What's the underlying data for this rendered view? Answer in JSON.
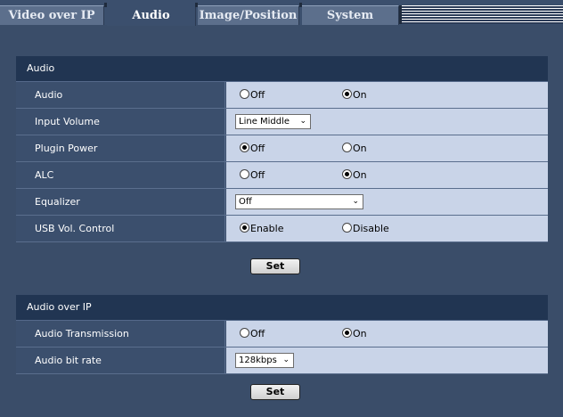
{
  "tabs": [
    {
      "label": "Video over IP"
    },
    {
      "label": "Audio"
    },
    {
      "label": "Image/Position"
    },
    {
      "label": "System"
    }
  ],
  "audio_section": {
    "title": "Audio",
    "audio": {
      "label": "Audio",
      "opt_off": "Off",
      "opt_on": "On",
      "selected": "On"
    },
    "input_volume": {
      "label": "Input Volume",
      "value": "Line Middle"
    },
    "plugin_power": {
      "label": "Plugin Power",
      "opt_off": "Off",
      "opt_on": "On",
      "selected": "Off"
    },
    "alc": {
      "label": "ALC",
      "opt_off": "Off",
      "opt_on": "On",
      "selected": "On"
    },
    "equalizer": {
      "label": "Equalizer",
      "value": "Off"
    },
    "usb_vol": {
      "label": "USB Vol. Control",
      "opt_enable": "Enable",
      "opt_disable": "Disable",
      "selected": "Enable"
    },
    "set_label": "Set"
  },
  "aoip_section": {
    "title": "Audio over IP",
    "transmission": {
      "label": "Audio Transmission",
      "opt_off": "Off",
      "opt_on": "On",
      "selected": "On"
    },
    "bit_rate": {
      "label": "Audio bit rate",
      "value": "128kbps"
    },
    "set_label": "Set"
  }
}
